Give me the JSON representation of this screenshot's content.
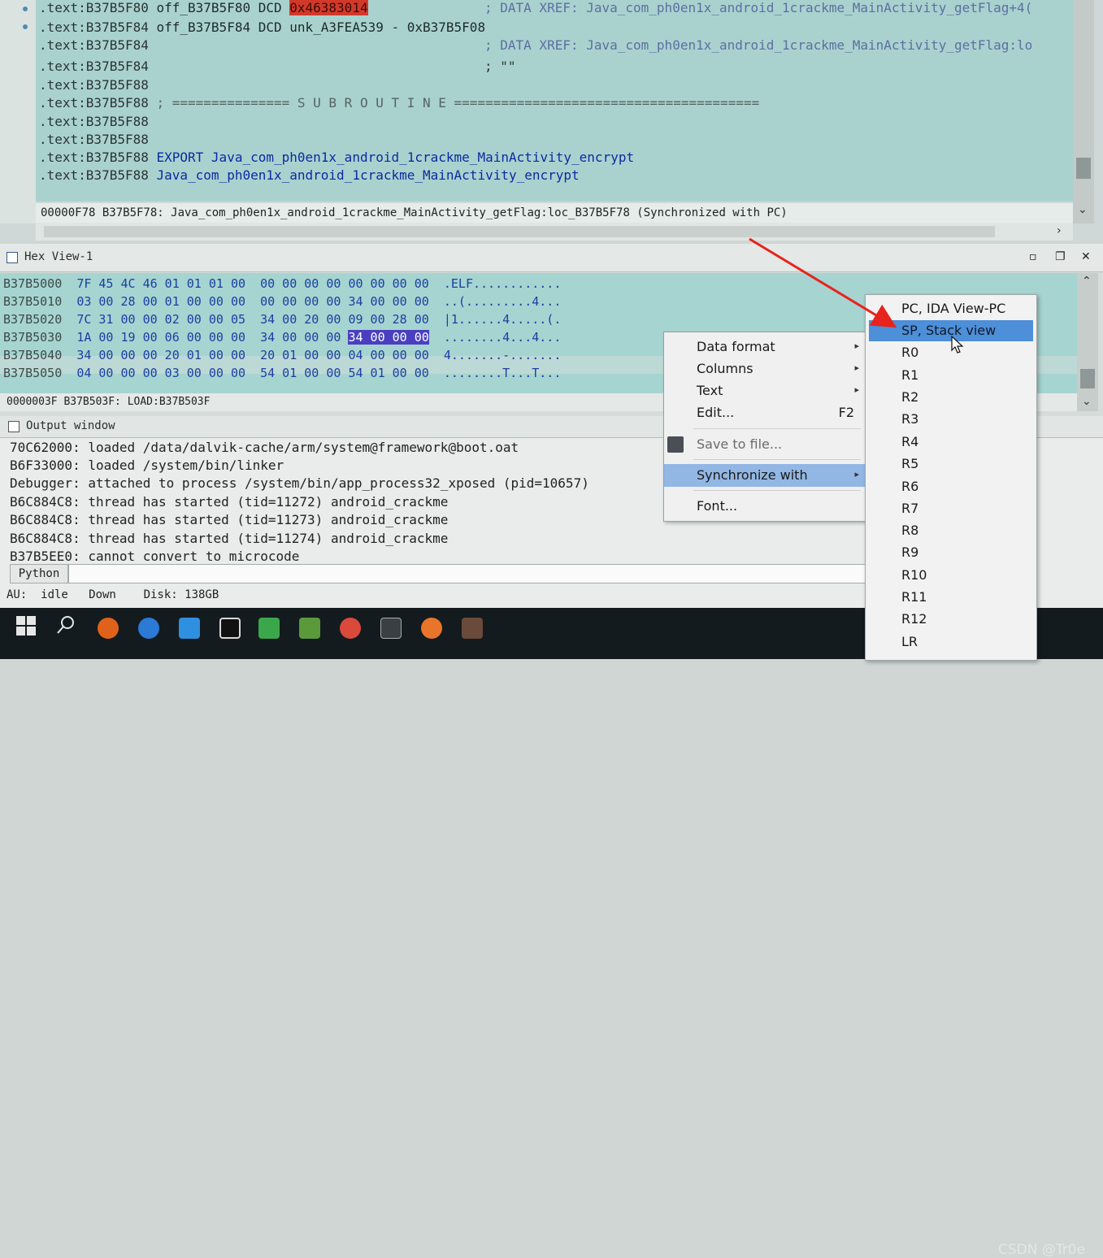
{
  "disasm": {
    "lines": [
      {
        "addr": ".text:B37B5F80",
        "op": " off_B37B5F80 DCD ",
        "hl": "0x46383014",
        "rest": "",
        "comment": "; DATA XREF: Java_com_ph0en1x_android_1crackme_MainActivity_getFlag+4("
      },
      {
        "addr": ".text:B37B5F84",
        "op": " off_B37B5F84 DCD unk_A3FEA539 - 0xB37B5F08",
        "hl": "",
        "rest": "",
        "comment": ""
      },
      {
        "addr": ".text:B37B5F84",
        "op": "",
        "hl": "",
        "rest": "",
        "comment": "; DATA XREF: Java_com_ph0en1x_android_1crackme_MainActivity_getFlag:lo"
      },
      {
        "addr": ".text:B37B5F84",
        "op": "",
        "hl": "",
        "rest": "",
        "comment": "; \"\""
      },
      {
        "addr": ".text:B37B5F88",
        "op": "",
        "hl": "",
        "rest": "",
        "comment": ""
      },
      {
        "addr": ".text:B37B5F88",
        "op": " ; =============== S U B R O U T I N E =======================================",
        "hl": "",
        "rest": "",
        "comment": ""
      },
      {
        "addr": ".text:B37B5F88",
        "op": "",
        "hl": "",
        "rest": "",
        "comment": ""
      },
      {
        "addr": ".text:B37B5F88",
        "op": "",
        "hl": "",
        "rest": "",
        "comment": ""
      },
      {
        "addr": ".text:B37B5F88",
        "op": " EXPORT Java_com_ph0en1x_android_1crackme_MainActivity_encrypt",
        "hl": "",
        "rest": "",
        "comment": ""
      },
      {
        "addr": ".text:B37B5F88",
        "op": " Java_com_ph0en1x_android_1crackme_MainActivity_encrypt",
        "hl": "",
        "rest": "",
        "comment": ""
      }
    ],
    "status": "00000F78 B37B5F78: Java_com_ph0en1x_android_1crackme_MainActivity_getFlag:loc_B37B5F78 (Synchronized with PC)"
  },
  "hexview": {
    "title": "Hex View-1",
    "rows": [
      {
        "addr": "B37B5000",
        "bytes_a": "7F 45 4C 46 01 01 01 00",
        "bytes_b": "00 00 00 00 00 00 00 00",
        "sel": "",
        "ascii": ".ELF............"
      },
      {
        "addr": "B37B5010",
        "bytes_a": "03 00 28 00 01 00 00 00",
        "bytes_b": "00 00 00 00 34 00 00 00",
        "sel": "",
        "ascii": "..(.........4..."
      },
      {
        "addr": "B37B5020",
        "bytes_a": "7C 31 00 00 02 00 00 05",
        "bytes_b": "34 00 20 00 09 00 28 00",
        "sel": "",
        "ascii": "|1......4.....(."
      },
      {
        "addr": "B37B5030",
        "bytes_a": "1A 00 19 00 06 00 00 00",
        "bytes_b": "34 00 00 00 ",
        "sel": "34 00 00 00",
        "ascii": "........4...4..."
      },
      {
        "addr": "B37B5040",
        "bytes_a": "34 00 00 00 20 01 00 00",
        "bytes_b": "20 01 00 00 04 00 00 00",
        "sel": "",
        "ascii": "4.......-......."
      },
      {
        "addr": "B37B5050",
        "bytes_a": "04 00 00 00 03 00 00 00",
        "bytes_b": "54 01 00 00 54 01 00 00",
        "sel": "",
        "ascii": "........T...T..."
      }
    ],
    "status": "0000003F B37B503F: LOAD:B37B503F"
  },
  "output": {
    "title": "Output window",
    "lines": [
      "70C62000: loaded /data/dalvik-cache/arm/system@framework@boot.oat",
      "B6F33000: loaded /system/bin/linker",
      "Debugger: attached to process /system/bin/app_process32_xposed (pid=10657)",
      "B6C884C8: thread has started (tid=11272) android_crackme",
      "B6C884C8: thread has started (tid=11273) android_crackme",
      "B6C884C8: thread has started (tid=11274) android_crackme",
      "B37B5EE0: cannot convert to microcode"
    ],
    "python_label": "Python",
    "au_status": "AU:  idle   Down    Disk: 138GB"
  },
  "context_menu": {
    "items": [
      {
        "label": "Data format",
        "key": "",
        "submenu": true
      },
      {
        "label": "Columns",
        "key": "",
        "submenu": true
      },
      {
        "label": "Text",
        "key": "",
        "submenu": true
      },
      {
        "label": "Edit...",
        "key": "F2",
        "submenu": false
      },
      {
        "label": "Save to file...",
        "key": "",
        "submenu": false
      },
      {
        "label": "Synchronize with",
        "key": "",
        "submenu": true
      },
      {
        "label": "Font...",
        "key": "",
        "submenu": false
      }
    ]
  },
  "submenu": {
    "items": [
      "PC, IDA View-PC",
      "SP, Stack view",
      "R0",
      "R1",
      "R2",
      "R3",
      "R4",
      "R5",
      "R6",
      "R7",
      "R8",
      "R9",
      "R10",
      "R11",
      "R12",
      "LR"
    ],
    "selected": "SP, Stack view"
  },
  "watermark": "CSDN @Tr0e",
  "colors": {
    "highlight_red": "#d2392b",
    "hex_selection": "#4a3fc0",
    "menu_active": "#4d8fd8",
    "arrow": "#e8231c"
  }
}
